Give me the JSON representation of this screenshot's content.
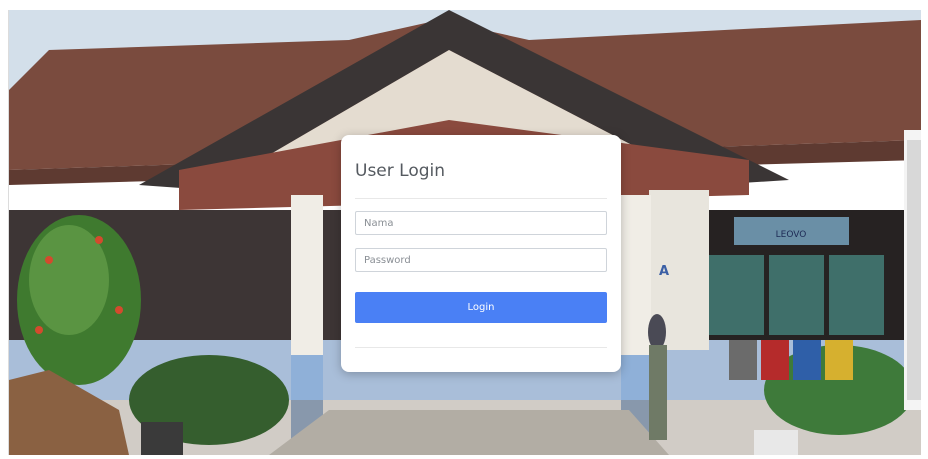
{
  "login": {
    "title": "User Login",
    "username_placeholder": "Nama",
    "password_placeholder": "Password",
    "submit_label": "Login"
  },
  "background": {
    "building_sign_text": "LEOVO",
    "wall_letter": "A"
  },
  "colors": {
    "primary_button": "#4a80f5",
    "card_background": "#ffffff",
    "title_text": "#555a60"
  }
}
